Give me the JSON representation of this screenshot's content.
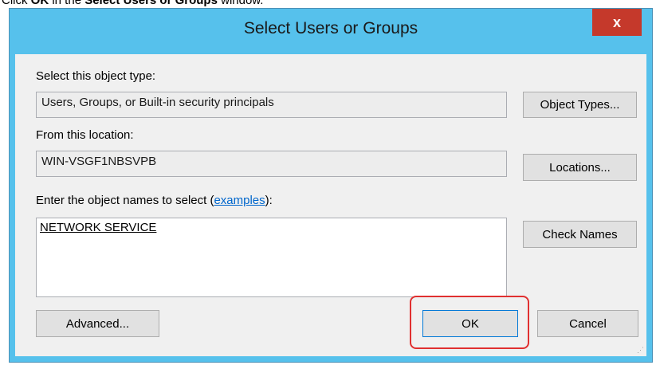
{
  "instruction": {
    "prefix": "Click ",
    "ok": "OK",
    "middle": " in the ",
    "window_name": "Select Users or Groups",
    "suffix": " window."
  },
  "window": {
    "title": "Select Users or Groups",
    "close_glyph": "x"
  },
  "object_type": {
    "label": "Select this object type:",
    "value": "Users, Groups, or Built-in security principals",
    "button": "Object Types..."
  },
  "location": {
    "label": "From this location:",
    "value": "WIN-VSGF1NBSVPB",
    "button": "Locations..."
  },
  "names": {
    "label_prefix": "Enter the object names to select (",
    "link": "examples",
    "label_suffix": "):",
    "value": "NETWORK SERVICE",
    "button": "Check Names"
  },
  "buttons": {
    "advanced": "Advanced...",
    "ok": "OK",
    "cancel": "Cancel"
  },
  "colors": {
    "titlebar": "#56c1ec",
    "close": "#c5392b",
    "highlight": "#e03030"
  },
  "icons": {
    "close": "close-icon",
    "grip": "resize-grip-icon"
  }
}
